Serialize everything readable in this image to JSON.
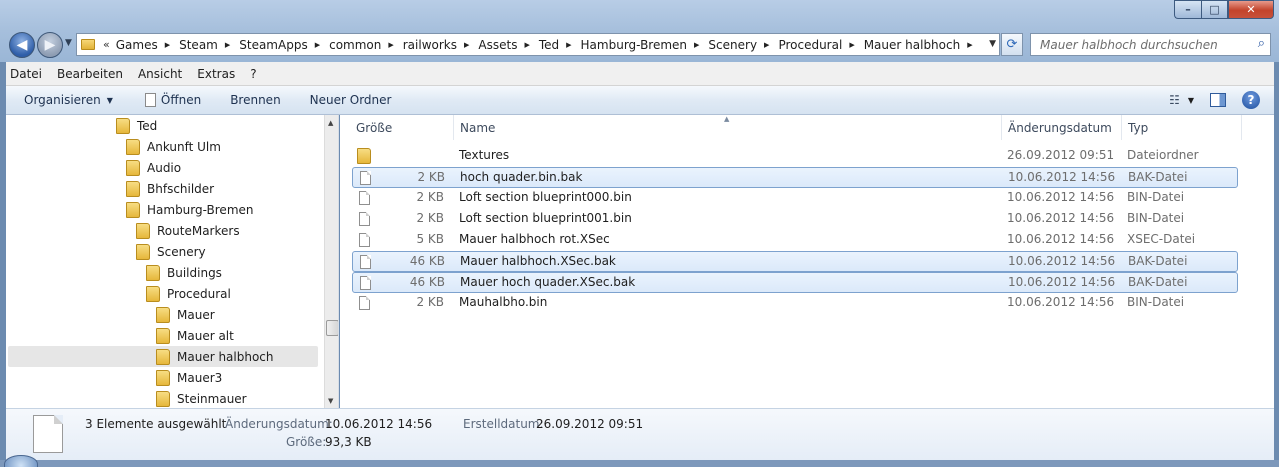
{
  "window": {
    "minimize": "–",
    "maximize": "□",
    "close": "✕"
  },
  "nav": {
    "back": "◀",
    "forward": "▶"
  },
  "address": {
    "overflow": "«",
    "crumbs": [
      "Games",
      "Steam",
      "SteamApps",
      "common",
      "railworks",
      "Assets",
      "Ted",
      "Hamburg-Bremen",
      "Scenery",
      "Procedural",
      "Mauer halbhoch"
    ]
  },
  "search": {
    "placeholder": "Mauer halbhoch durchsuchen"
  },
  "menu": [
    "Datei",
    "Bearbeiten",
    "Ansicht",
    "Extras",
    "?"
  ],
  "toolbar": {
    "organize": "Organisieren",
    "open": "Öffnen",
    "burn": "Brennen",
    "new_folder": "Neuer Ordner"
  },
  "tree": [
    {
      "label": "Ted",
      "level": 0
    },
    {
      "label": "Ankunft Ulm",
      "level": 1
    },
    {
      "label": "Audio",
      "level": 1
    },
    {
      "label": "Bhfschilder",
      "level": 1
    },
    {
      "label": "Hamburg-Bremen",
      "level": 1
    },
    {
      "label": "RouteMarkers",
      "level": 2
    },
    {
      "label": "Scenery",
      "level": 2
    },
    {
      "label": "Buildings",
      "level": 3
    },
    {
      "label": "Procedural",
      "level": 3
    },
    {
      "label": "Mauer",
      "level": 4
    },
    {
      "label": "Mauer alt",
      "level": 4
    },
    {
      "label": "Mauer halbhoch",
      "level": 4,
      "selected": true
    },
    {
      "label": "Mauer3",
      "level": 4
    },
    {
      "label": "Steinmauer",
      "level": 4
    }
  ],
  "columns": {
    "size": "Größe",
    "name": "Name",
    "date": "Änderungsdatum",
    "type": "Typ"
  },
  "files": [
    {
      "size": "",
      "name": "Textures",
      "date": "26.09.2012 09:51",
      "type": "Dateiordner",
      "folder": true,
      "selected": false
    },
    {
      "size": "2 KB",
      "name": "hoch quader.bin.bak",
      "date": "10.06.2012 14:56",
      "type": "BAK-Datei",
      "folder": false,
      "selected": true
    },
    {
      "size": "2 KB",
      "name": "Loft section blueprint000.bin",
      "date": "10.06.2012 14:56",
      "type": "BIN-Datei",
      "folder": false,
      "selected": false
    },
    {
      "size": "2 KB",
      "name": "Loft section blueprint001.bin",
      "date": "10.06.2012 14:56",
      "type": "BIN-Datei",
      "folder": false,
      "selected": false
    },
    {
      "size": "5 KB",
      "name": "Mauer halbhoch rot.XSec",
      "date": "10.06.2012 14:56",
      "type": "XSEC-Datei",
      "folder": false,
      "selected": false
    },
    {
      "size": "46 KB",
      "name": "Mauer halbhoch.XSec.bak",
      "date": "10.06.2012 14:56",
      "type": "BAK-Datei",
      "folder": false,
      "selected": true
    },
    {
      "size": "46 KB",
      "name": "Mauer hoch quader.XSec.bak",
      "date": "10.06.2012 14:56",
      "type": "BAK-Datei",
      "folder": false,
      "selected": true
    },
    {
      "size": "2 KB",
      "name": "Mauhalbho.bin",
      "date": "10.06.2012 14:56",
      "type": "BIN-Datei",
      "folder": false,
      "selected": false
    }
  ],
  "details": {
    "summary": "3 Elemente ausgewählt",
    "modified_label": "Änderungsdatum:",
    "modified_value": "10.06.2012 14:56",
    "created_label": "Erstelldatum:",
    "created_value": "26.09.2012 09:51",
    "size_label": "Größe:",
    "size_value": "93,3 KB"
  }
}
